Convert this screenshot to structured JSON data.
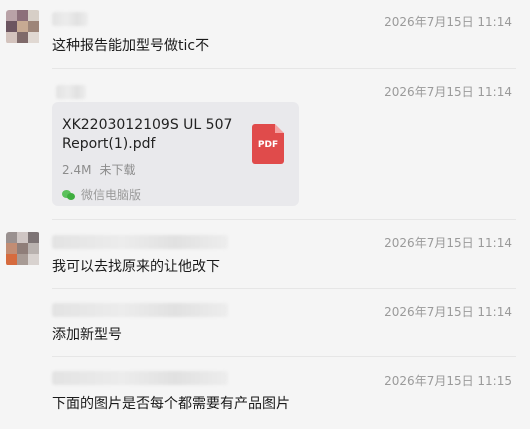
{
  "messages": [
    {
      "time": "2026年7月15日 11:14",
      "text": "这种报告能加型号做tic不"
    },
    {
      "time": "2026年7月15日 11:14",
      "file": {
        "name": "XK2203012109S UL 507 Report(1).pdf",
        "size": "2.4M",
        "status": "未下载",
        "icon_label": "PDF",
        "source": "微信电脑版"
      }
    },
    {
      "time": "2026年7月15日 11:14",
      "text": "我可以去找原来的让他改下"
    },
    {
      "time": "2026年7月15日 11:14",
      "text": "添加新型号"
    },
    {
      "time": "2026年7月15日 11:15",
      "text": "下面的图片是否每个都需要有产品图片"
    }
  ]
}
